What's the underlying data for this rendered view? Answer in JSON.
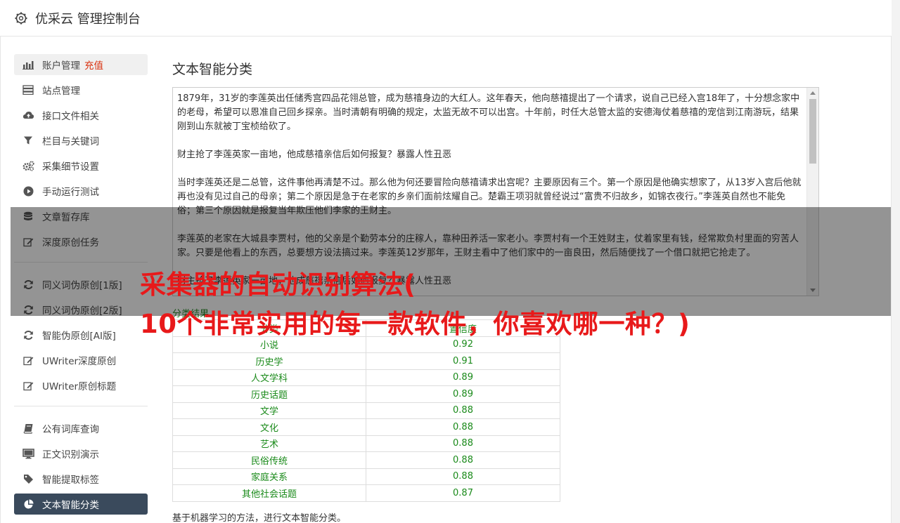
{
  "header": {
    "title": "优采云 管理控制台"
  },
  "sidebar": {
    "group1": [
      {
        "label": "账户管理",
        "badge": "充值",
        "icon": "bar-chart-icon"
      },
      {
        "label": "站点管理",
        "icon": "server-icon"
      },
      {
        "label": "接口文件相关",
        "icon": "cloud-upload-icon"
      },
      {
        "label": "栏目与关键词",
        "icon": "filter-icon"
      },
      {
        "label": "采集细节设置",
        "icon": "gears-icon"
      },
      {
        "label": "手动运行测试",
        "icon": "play-circle-icon"
      },
      {
        "label": "文章暂存库",
        "icon": "database-icon"
      },
      {
        "label": "深度原创任务",
        "icon": "edit-icon"
      }
    ],
    "group2": [
      {
        "label": "同义词伪原创[1版]",
        "icon": "refresh-icon"
      },
      {
        "label": "同义词伪原创[2版]",
        "icon": "refresh-icon"
      },
      {
        "label": "智能伪原创[AI版]",
        "icon": "refresh-icon"
      },
      {
        "label": "UWriter深度原创",
        "icon": "edit-icon"
      },
      {
        "label": "UWriter原创标题",
        "icon": "edit-icon"
      }
    ],
    "group3": [
      {
        "label": "公有词库查询",
        "icon": "book-icon"
      },
      {
        "label": "正文识别演示",
        "icon": "monitor-icon"
      },
      {
        "label": "智能提取标签",
        "icon": "tag-icon"
      },
      {
        "label": "文本智能分类",
        "icon": "pie-chart-icon"
      }
    ]
  },
  "main": {
    "title": "文本智能分类",
    "text_paragraphs": [
      "1879年，31岁的李莲英出任储秀宫四品花翎总管，成为慈禧身边的大红人。这年春天，他向慈禧提出了一个请求，说自己已经入宫18年了，十分想念家中的老母，希望可以恩准自己回乡探亲。当时清朝有明确的规定，太监无故不可以出宫。十年前，时任大总管太监的安德海仗着慈禧的宠信到江南游玩，结果刚到山东就被丁宝桢给砍了。",
      "财主抢了李莲英家一亩地，他成慈禧亲信后如何报复？暴露人性丑恶",
      "当时李莲英还是二总管，这件事他再清楚不过。那么他为何还要冒险向慈禧请求出宫呢？主要原因有三个。第一个原因是他确实想家了，从13岁入宫后他就再也没有见过自己的母亲；第二个原因是急于在老家的乡亲们面前炫耀自己。楚霸王项羽就曾经说过“富贵不归故乡，如锦衣夜行。”李莲英自然也不能免俗；第三个原因就是报复当年欺压他们李家的王财主。",
      "李莲英的老家在大城县李贾村，他的父亲是个勤劳本分的庄稼人，靠种田养活一家老小。李贾村有一个王姓财主，仗着家里有钱，经常欺负村里面的穷苦人家。只要是他看上的东西，总要想方设法搞过来。李莲英12岁那年，王财主看中了他们家中的一亩良田，然后随便找了一个借口就把它抢走了。",
      "财主抢了李莲英家一亩地，他成慈禧亲信后如何报复？暴露人性丑恶"
    ],
    "result_label": "分类结果",
    "table": {
      "headers": [
        "分类",
        "置信度"
      ],
      "rows": [
        [
          "小说",
          "0.92"
        ],
        [
          "历史学",
          "0.91"
        ],
        [
          "人文学科",
          "0.89"
        ],
        [
          "历史话题",
          "0.89"
        ],
        [
          "文学",
          "0.88"
        ],
        [
          "文化",
          "0.88"
        ],
        [
          "艺术",
          "0.88"
        ],
        [
          "民俗传统",
          "0.88"
        ],
        [
          "家庭关系",
          "0.88"
        ],
        [
          "其他社会话题",
          "0.87"
        ]
      ]
    },
    "footnote": "基于机器学习的方法，进行文本智能分类。"
  },
  "overlay": {
    "line1": "采集器的自动识别算法(",
    "line2": "10个非常实用的每一款软件，你喜欢哪一种？)"
  }
}
